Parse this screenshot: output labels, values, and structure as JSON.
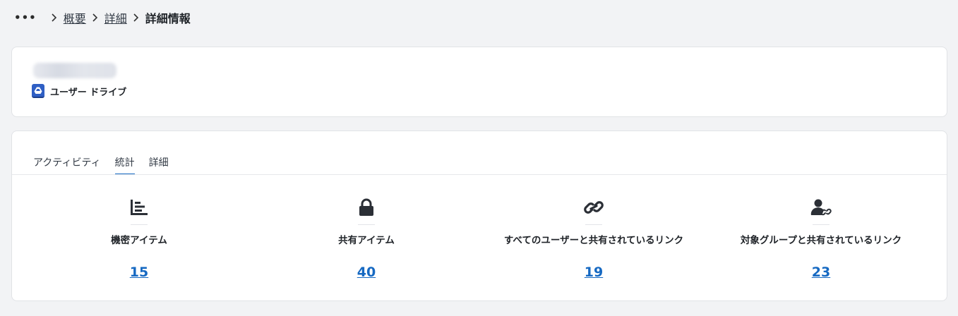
{
  "breadcrumb": {
    "more": "•••",
    "items": [
      {
        "label": "概要"
      },
      {
        "label": "詳細"
      }
    ],
    "current": "詳細情報"
  },
  "drive": {
    "label": "ユーザー ドライブ",
    "icon": "drive-icon"
  },
  "tabs": [
    {
      "label": "アクティビティ",
      "active": false
    },
    {
      "label": "統計",
      "active": true
    },
    {
      "label": "詳細",
      "active": false
    }
  ],
  "stats": [
    {
      "label": "機密アイテム",
      "value": "15",
      "icon": "bar-chart-icon"
    },
    {
      "label": "共有アイテム",
      "value": "40",
      "icon": "lock-icon"
    },
    {
      "label": "すべてのユーザーと共有されているリンク",
      "value": "19",
      "icon": "link-icon"
    },
    {
      "label": "対象グループと共有されているリンク",
      "value": "23",
      "icon": "user-link-icon"
    }
  ],
  "colors": {
    "accent": "#1669c2",
    "page_bg": "#f2f3f5",
    "card_bg": "#ffffff",
    "drive_icon": "#2f5fc4"
  }
}
